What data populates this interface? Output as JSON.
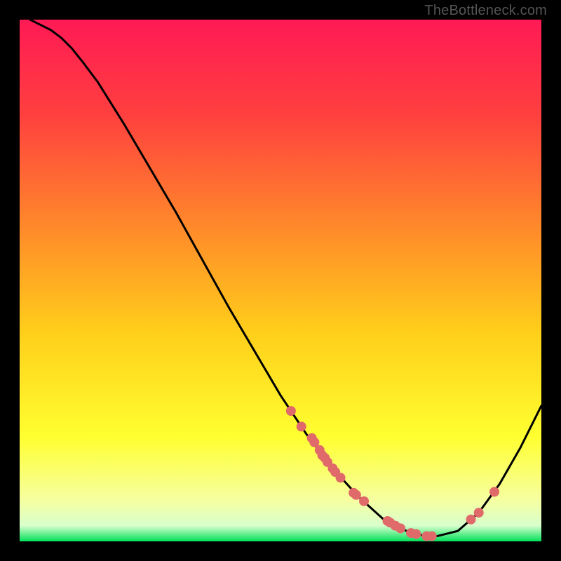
{
  "watermark": "TheBottleneck.com",
  "chart_data": {
    "type": "line",
    "title": "",
    "xlabel": "",
    "ylabel": "",
    "xlim": [
      0,
      100
    ],
    "ylim": [
      0,
      100
    ],
    "grid": false,
    "legend": false,
    "gradient_stops": [
      {
        "offset": 0,
        "color": "#ff1a55"
      },
      {
        "offset": 18,
        "color": "#ff3f3f"
      },
      {
        "offset": 40,
        "color": "#ff8a2a"
      },
      {
        "offset": 60,
        "color": "#ffcf1a"
      },
      {
        "offset": 80,
        "color": "#ffff30"
      },
      {
        "offset": 92,
        "color": "#f6ffa0"
      },
      {
        "offset": 97,
        "color": "#d8ffcc"
      },
      {
        "offset": 100,
        "color": "#00e05a"
      }
    ],
    "series": [
      {
        "name": "bottleneck-curve",
        "x": [
          2,
          4,
          6,
          8,
          10,
          12,
          15,
          20,
          25,
          30,
          35,
          40,
          45,
          50,
          55,
          60,
          65,
          70,
          72,
          75,
          78,
          80,
          84,
          88,
          92,
          96,
          100
        ],
        "y": [
          100,
          99,
          98,
          96.5,
          94.5,
          92,
          88,
          80,
          71.5,
          63,
          54,
          45,
          36.5,
          28,
          20.5,
          14,
          8.5,
          4,
          3,
          1.6,
          1,
          1,
          2,
          5.5,
          11,
          18,
          26
        ],
        "color": "#000000",
        "stroke_width": 3
      }
    ],
    "scatter_points": {
      "name": "sample-points",
      "color": "#e06a6a",
      "radius": 7,
      "x": [
        52,
        54,
        56,
        56.5,
        57.5,
        58.5,
        58,
        59,
        60,
        60.5,
        61.5,
        64,
        64.5,
        66,
        70.5,
        71,
        72,
        73,
        75,
        76,
        78,
        79,
        86.5,
        88,
        91
      ],
      "y": [
        25,
        22,
        19.8,
        19,
        17.5,
        16,
        16.5,
        15.2,
        14,
        13.3,
        12.2,
        9.3,
        8.9,
        7.7,
        3.9,
        3.6,
        3,
        2.5,
        1.6,
        1.4,
        1,
        1,
        4.2,
        5.5,
        9.5
      ]
    }
  }
}
